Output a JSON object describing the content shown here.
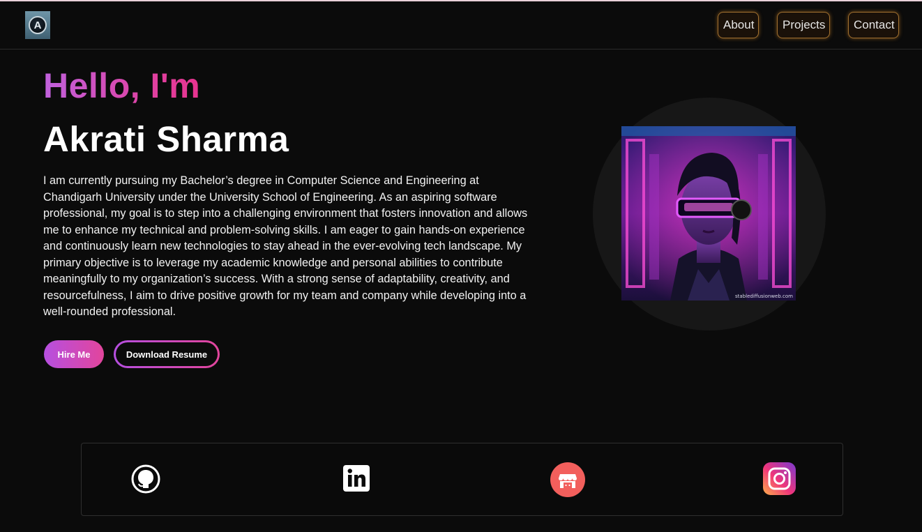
{
  "nav": {
    "logo_letter": "A",
    "about": "About",
    "projects": "Projects",
    "contact": "Contact"
  },
  "hero": {
    "greeting": "Hello, I'm",
    "name": "Akrati Sharma",
    "bio": "I am currently pursuing my Bachelor’s degree in Computer Science and Engineering at Chandigarh University under the University School of Engineering. As an aspiring software professional, my goal is to step into a challenging environment that fosters innovation and allows me to enhance my technical and problem-solving skills. I am eager to gain hands-on experience and continuously learn new technologies to stay ahead in the ever-evolving tech landscape. My primary objective is to leverage my academic knowledge and personal abilities to contribute meaningfully to my organization’s success. With a strong sense of adaptability, creativity, and resourcefulness, I aim to drive positive growth for my team and company while developing into a well-rounded professional.",
    "hire_label": "Hire Me",
    "resume_label": "Download Resume"
  },
  "portrait": {
    "watermark": "stablediffusionweb.com"
  },
  "social": {
    "icons": [
      "github-icon",
      "linkedin-icon",
      "shop-icon",
      "instagram-icon"
    ]
  },
  "colors": {
    "background": "#0b0b0b",
    "accent_purple": "#b64fe0",
    "accent_pink": "#e2459c",
    "nav_border": "#a07030"
  }
}
